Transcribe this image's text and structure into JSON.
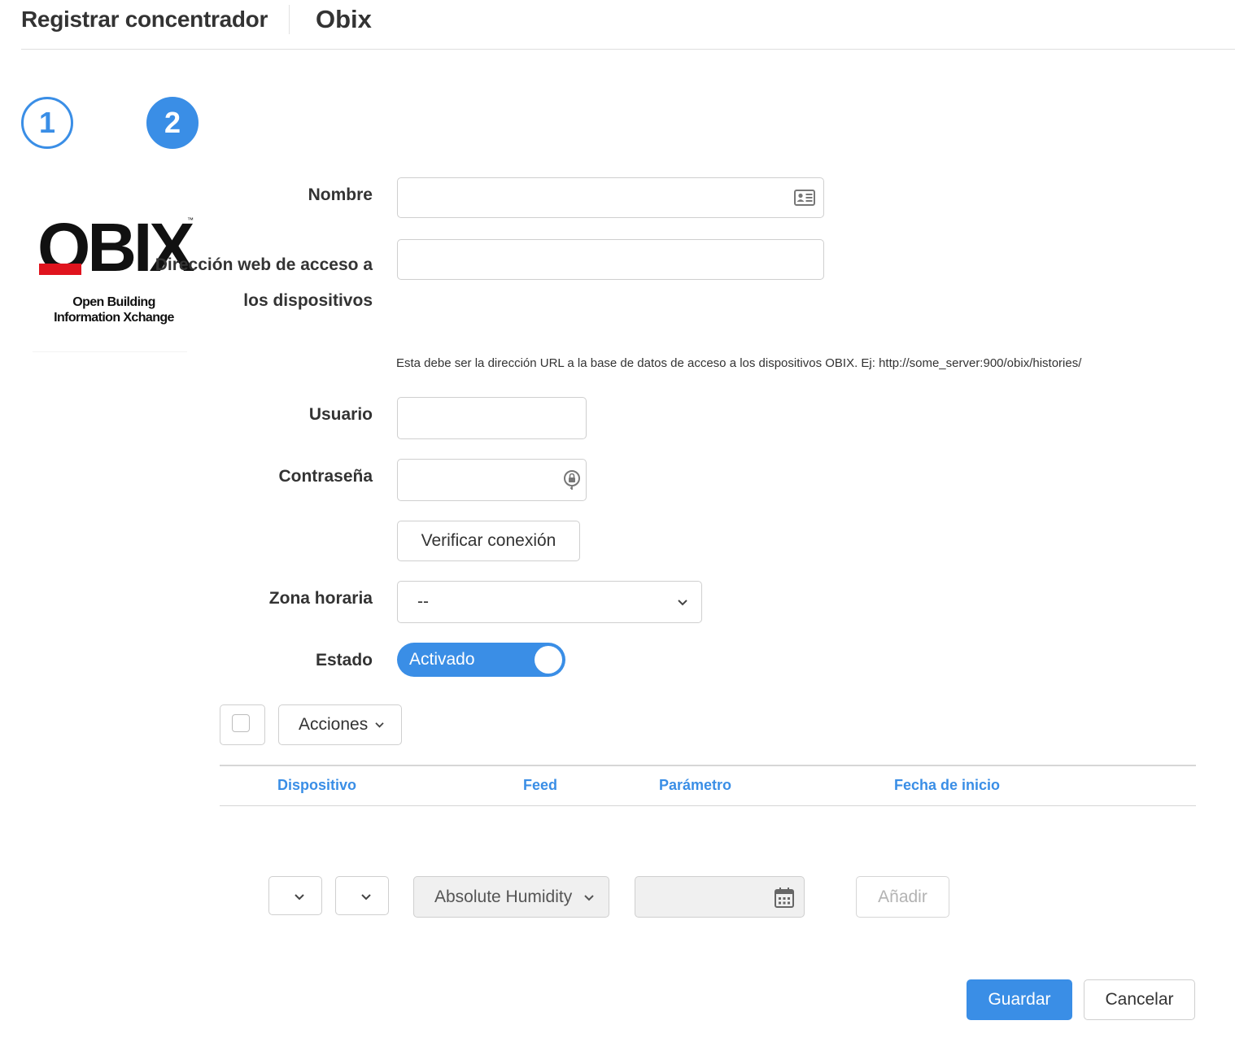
{
  "header": {
    "title": "Registrar concentrador",
    "subtitle": "Obix"
  },
  "steps": [
    {
      "number": "1"
    },
    {
      "number": "2"
    }
  ],
  "logo": {
    "word": "OBIX",
    "line1": "Open Building",
    "line2": "Information Xchange"
  },
  "form": {
    "nombre": {
      "label": "Nombre",
      "value": ""
    },
    "url": {
      "label": "Dirección web de acceso a los dispositivos",
      "value": "",
      "hint": "Esta debe ser la dirección URL a la base de datos de acceso a los dispositivos OBIX. Ej: http://some_server:900/obix/histories/"
    },
    "usuario": {
      "label": "Usuario",
      "value": ""
    },
    "contrasena": {
      "label": "Contraseña",
      "value": ""
    },
    "verify_label": "Verificar conexión",
    "zona": {
      "label": "Zona horaria",
      "value": "--"
    },
    "estado": {
      "label": "Estado",
      "toggle_text": "Activado",
      "on": true
    }
  },
  "toolbar": {
    "acciones_label": "Acciones"
  },
  "table": {
    "columns": [
      "Dispositivo",
      "Feed",
      "Parámetro",
      "Fecha de inicio"
    ],
    "rows": []
  },
  "add_row": {
    "parametro_value": "Absolute Humidity",
    "add_label": "Añadir"
  },
  "footer": {
    "save_label": "Guardar",
    "cancel_label": "Cancelar"
  },
  "colors": {
    "accent": "#3a8ee6",
    "logo_red": "#e0141e"
  },
  "icons": [
    "contact-card-icon",
    "password-key-icon",
    "chevron-down-icon",
    "calendar-icon"
  ]
}
